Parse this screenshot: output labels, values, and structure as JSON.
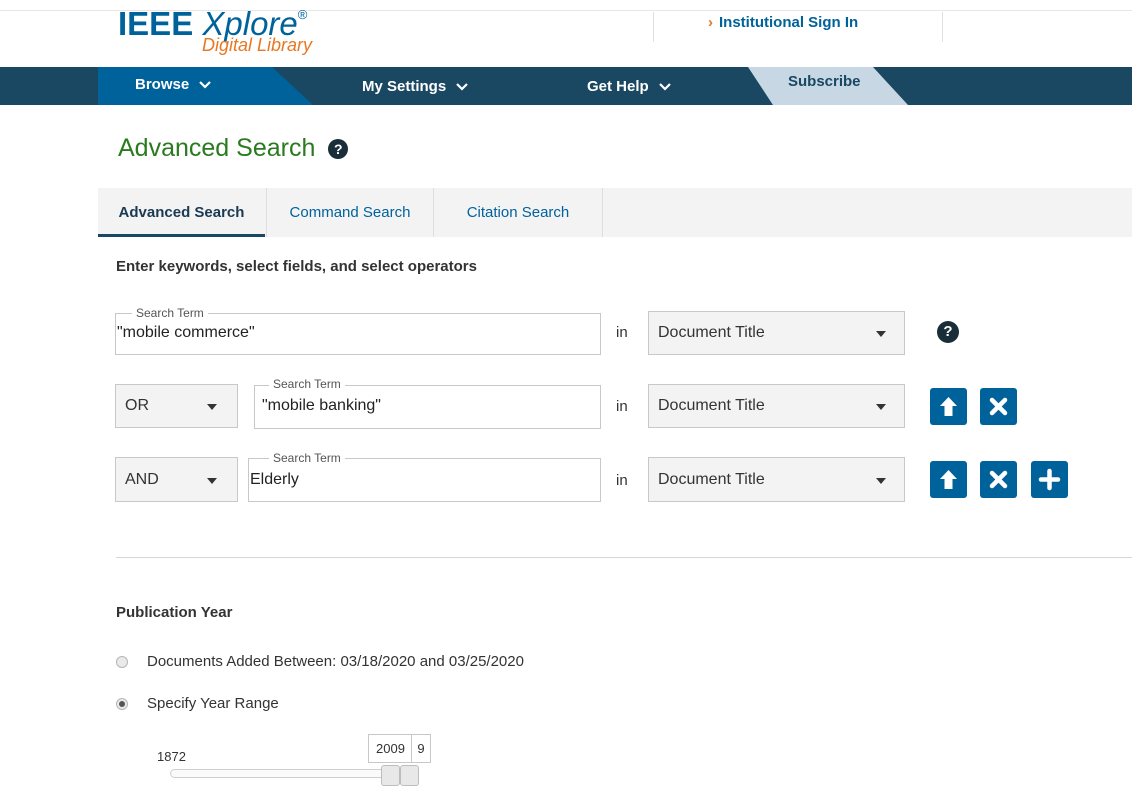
{
  "header": {
    "logo_main": "IEEE",
    "logo_xplore": "Xplore",
    "logo_reg": "®",
    "logo_sub": "Digital Library",
    "institutional_sign_in": "Institutional Sign In"
  },
  "nav": {
    "browse": "Browse",
    "my_settings": "My Settings",
    "get_help": "Get Help",
    "subscribe": "Subscribe"
  },
  "page": {
    "title": "Advanced Search",
    "tabs": [
      {
        "label": "Advanced Search",
        "active": true
      },
      {
        "label": "Command Search",
        "active": false
      },
      {
        "label": "Citation Search",
        "active": false
      }
    ],
    "instruction": "Enter keywords, select fields, and select operators"
  },
  "search_rows": [
    {
      "operator": "",
      "legend": "Search Term",
      "value": "\"mobile commerce\"",
      "in_label": "in",
      "field": "Document Title"
    },
    {
      "operator": "OR",
      "legend": "Search Term",
      "value": "\"mobile banking\"",
      "in_label": "in",
      "field": "Document Title"
    },
    {
      "operator": "AND",
      "legend": "Search Term",
      "value": "Elderly",
      "in_label": "in",
      "field": "Document Title"
    }
  ],
  "publication_year": {
    "heading": "Publication Year",
    "option_added": "Documents Added Between: 03/18/2020 and 03/25/2020",
    "option_range": "Specify Year Range",
    "selected": "Specify Year Range",
    "range_min_label": "1872",
    "from_value": "2009",
    "to_value_partial": "9"
  },
  "colors": {
    "brand_blue": "#00629b",
    "nav_dark": "#1a4762",
    "title_green": "#2a7a1f",
    "accent_orange": "#e87722"
  },
  "icons": {
    "help": "question-circle-icon",
    "move_up": "arrow-up-icon",
    "remove": "x-icon",
    "add": "plus-icon",
    "dropdown": "caret-down-icon"
  }
}
